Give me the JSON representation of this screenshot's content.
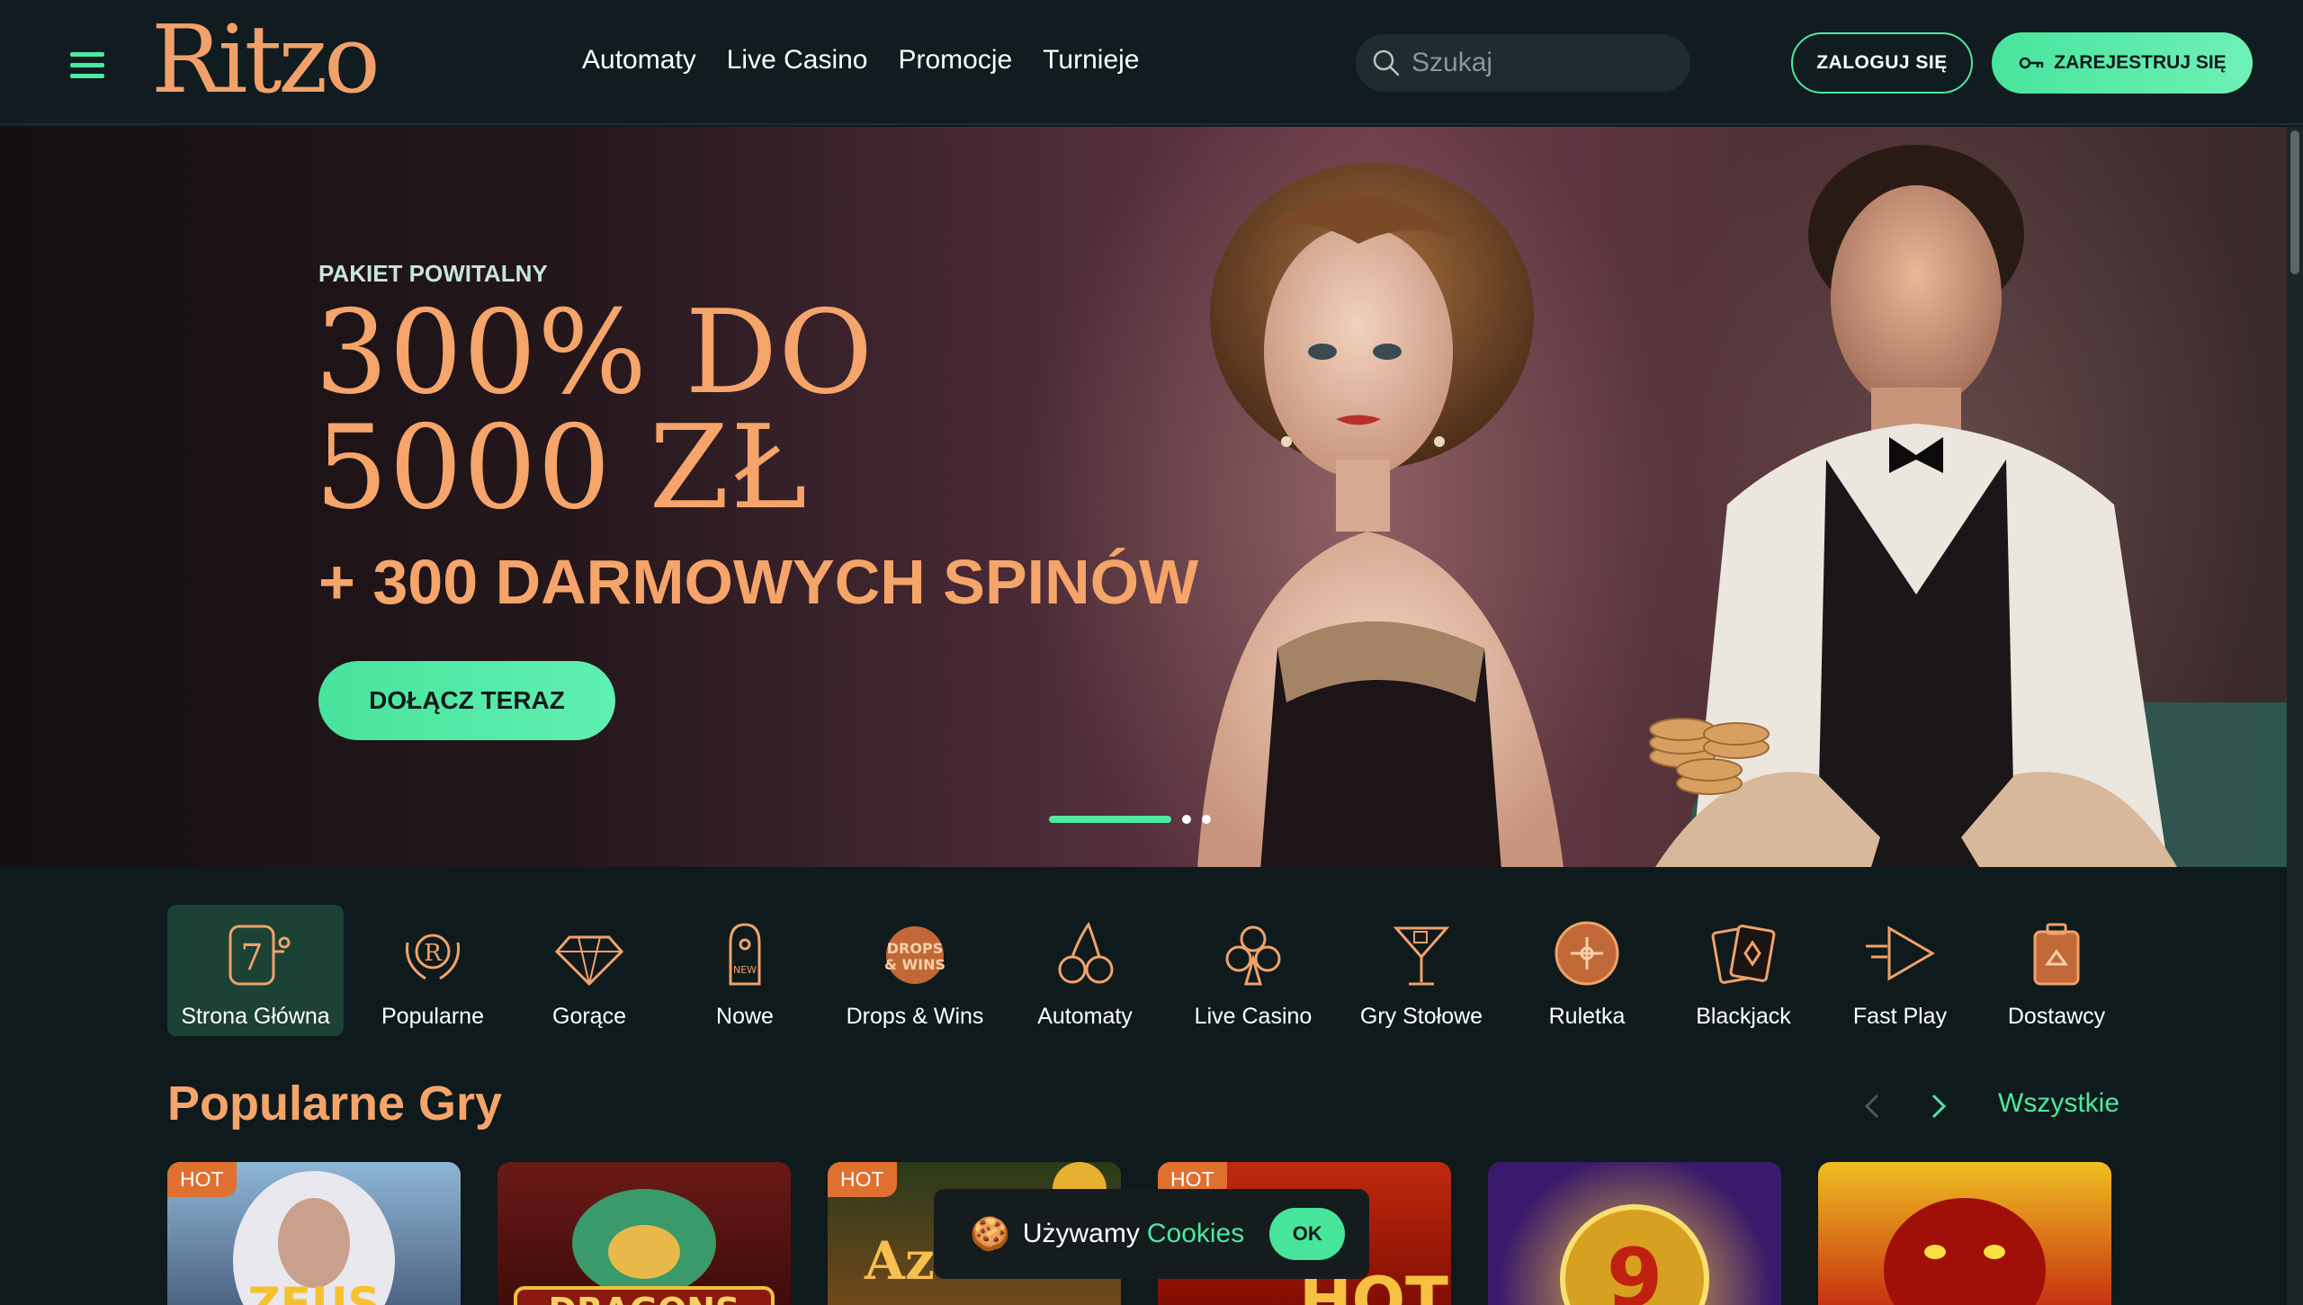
{
  "header": {
    "logo": "Ritzo",
    "nav": [
      "Automaty",
      "Live Casino",
      "Promocje",
      "Turnieje"
    ],
    "search_placeholder": "Szukaj",
    "login_label": "ZALOGUJ SIĘ",
    "register_label": "ZAREJESTRUJ SIĘ"
  },
  "hero": {
    "subtitle": "PAKIET POWITALNY",
    "title_line1": "300% DO",
    "title_line2": "5000 ZŁ",
    "title_line3": "+ 300 DARMOWYCH SPINÓW",
    "cta_label": "DOŁĄCZ TERAZ",
    "slides_count": 3,
    "active_slide": 1
  },
  "categories": [
    {
      "label": "Strona Główna",
      "icon": "slot-machine-icon",
      "active": true
    },
    {
      "label": "Popularne",
      "icon": "laurel-icon",
      "active": false
    },
    {
      "label": "Gorące",
      "icon": "diamond-icon",
      "active": false
    },
    {
      "label": "Nowe",
      "icon": "new-tag-icon",
      "active": false
    },
    {
      "label": "Drops & Wins",
      "icon": "drops-wins-icon",
      "active": false
    },
    {
      "label": "Automaty",
      "icon": "cherries-icon",
      "active": false
    },
    {
      "label": "Live Casino",
      "icon": "club-icon",
      "active": false
    },
    {
      "label": "Gry Stołowe",
      "icon": "cocktail-icon",
      "active": false
    },
    {
      "label": "Ruletka",
      "icon": "roulette-icon",
      "active": false
    },
    {
      "label": "Blackjack",
      "icon": "cards-icon",
      "active": false
    },
    {
      "label": "Fast Play",
      "icon": "fast-play-icon",
      "active": false
    },
    {
      "label": "Dostawcy",
      "icon": "provider-icon",
      "active": false
    }
  ],
  "popular": {
    "title": "Popularne Gry",
    "all_label": "Wszystkie",
    "games": [
      {
        "badge": "HOT",
        "theme": "zeus"
      },
      {
        "badge": "",
        "theme": "dragons"
      },
      {
        "badge": "HOT",
        "theme": "aztec"
      },
      {
        "badge": "HOT",
        "theme": "hot"
      },
      {
        "badge": "",
        "theme": "9-coins"
      },
      {
        "badge": "",
        "theme": "dragon-red"
      }
    ]
  },
  "cookie": {
    "text": "Używamy",
    "link": "Cookies",
    "ok_label": "OK"
  }
}
